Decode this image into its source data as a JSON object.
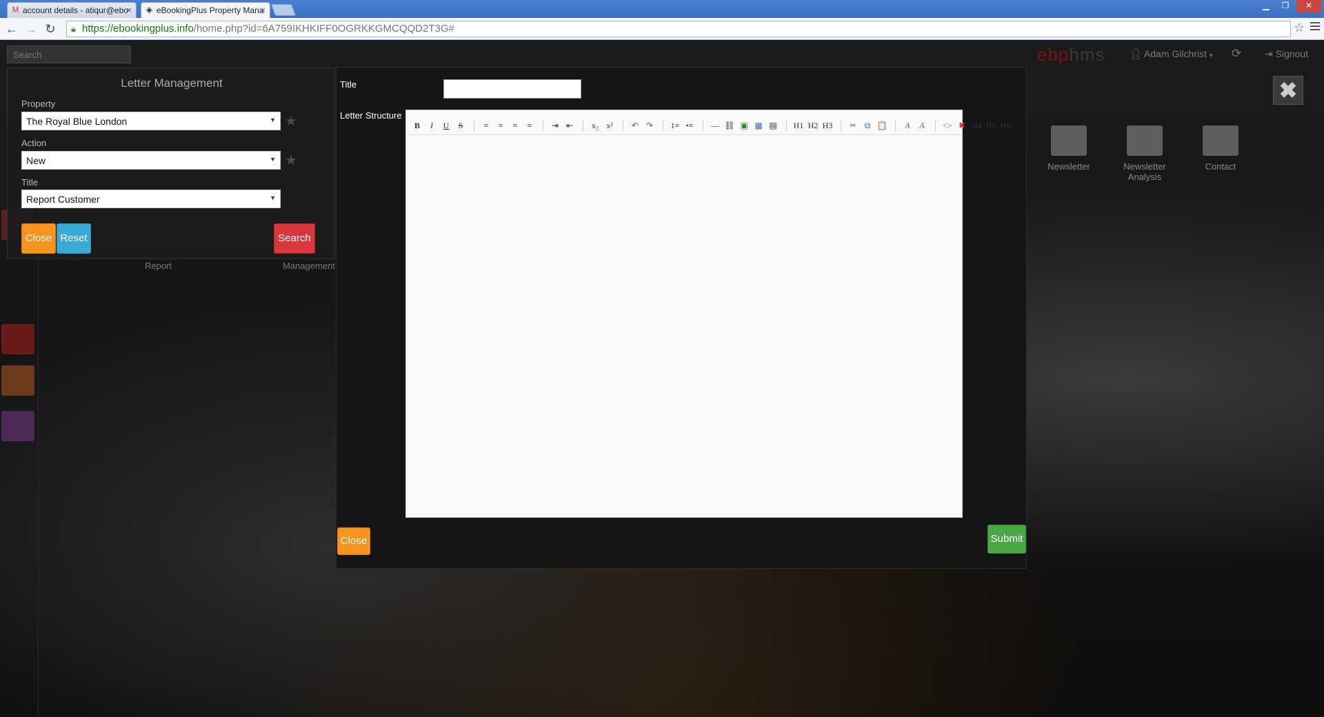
{
  "browser": {
    "tabs": [
      {
        "label": "account details - atiqur@ebo",
        "icon": "gmail-icon",
        "active": false
      },
      {
        "label": "eBookingPlus Property Mana",
        "icon": "ebp-icon",
        "active": true
      }
    ],
    "url_scheme": "https://",
    "url_host": "ebookingplus.info",
    "url_path": "/home.php?id=6A759IKHKIFF0OGRKKGMCQQD2T3G#"
  },
  "app": {
    "search_placeholder": "Search",
    "brand_part1": "ebp",
    "brand_part2": "hms",
    "user_name": "Adam Gilchrist",
    "signout_label": "Signout",
    "bg_tiles": [
      {
        "label": "Newsletter",
        "icon": "envelope-icon"
      },
      {
        "label": "Newsletter Analysis",
        "icon": "envelope-gear-icon"
      },
      {
        "label": "Contact",
        "icon": "contact-folder-icon"
      }
    ],
    "bg_labels": [
      "Report",
      "Management"
    ]
  },
  "letter_management": {
    "title": "Letter Management",
    "property_label": "Property",
    "property_value": "The Royal Blue London",
    "action_label": "Action",
    "action_value": "New",
    "title_label": "Title",
    "title_value": "Report Customer",
    "close_label": "Close",
    "reset_label": "Reset",
    "search_label": "Search"
  },
  "editor_modal": {
    "title_label": "Title",
    "title_value": "",
    "structure_label": "Letter Structure",
    "toolbar_groups": [
      [
        "B",
        "I",
        "U",
        "S"
      ],
      [
        "≡",
        "≡",
        "≡",
        "≡"
      ],
      [
        "⇥",
        "⇤"
      ],
      [
        "x₂",
        "x²"
      ],
      [
        "↶",
        "↷"
      ],
      [
        "1≡",
        "•≡"
      ],
      [
        "—",
        "⛓",
        "▣",
        "▦",
        "▤"
      ],
      [
        "H1",
        "H2",
        "H3"
      ],
      [
        "✂",
        "⧉",
        "📋"
      ],
      [
        "A",
        "A"
      ],
      [
        "<>",
        "✖",
        "H4",
        "H5",
        "H6"
      ]
    ],
    "close_label": "Close",
    "submit_label": "Submit"
  },
  "colors": {
    "orange": "#f7941d",
    "blue": "#39a9d6",
    "red": "#d9363e",
    "green": "#4aa745",
    "brand_red": "#7a1414"
  }
}
